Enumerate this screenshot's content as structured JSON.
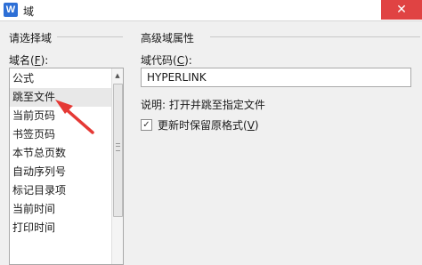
{
  "window": {
    "title": "域",
    "app_icon": "W",
    "close_icon": "close-icon"
  },
  "left_pane": {
    "group_title": "请选择域",
    "field_name_label": "域名(",
    "field_name_hotkey": "F",
    "field_name_label_end": "):",
    "items": [
      {
        "label": "公式"
      },
      {
        "label": "跳至文件",
        "selected": true
      },
      {
        "label": "当前页码"
      },
      {
        "label": "书签页码"
      },
      {
        "label": "本节总页数"
      },
      {
        "label": "自动序列号"
      },
      {
        "label": "标记目录项"
      },
      {
        "label": "当前时间"
      },
      {
        "label": "打印时间"
      }
    ]
  },
  "right_pane": {
    "group_title": "高级域属性",
    "code_label": "域代码(",
    "code_hotkey": "C",
    "code_label_end": "):",
    "code_value": "HYPERLINK",
    "description": "说明: 打开并跳至指定文件",
    "checkbox_label": "更新时保留原格式(",
    "checkbox_hotkey": "V",
    "checkbox_label_end": ")",
    "checkbox_checked": true
  },
  "colors": {
    "annotation_arrow": "#e53935",
    "close_button": "#e04343",
    "app_icon": "#2d6fd6"
  }
}
